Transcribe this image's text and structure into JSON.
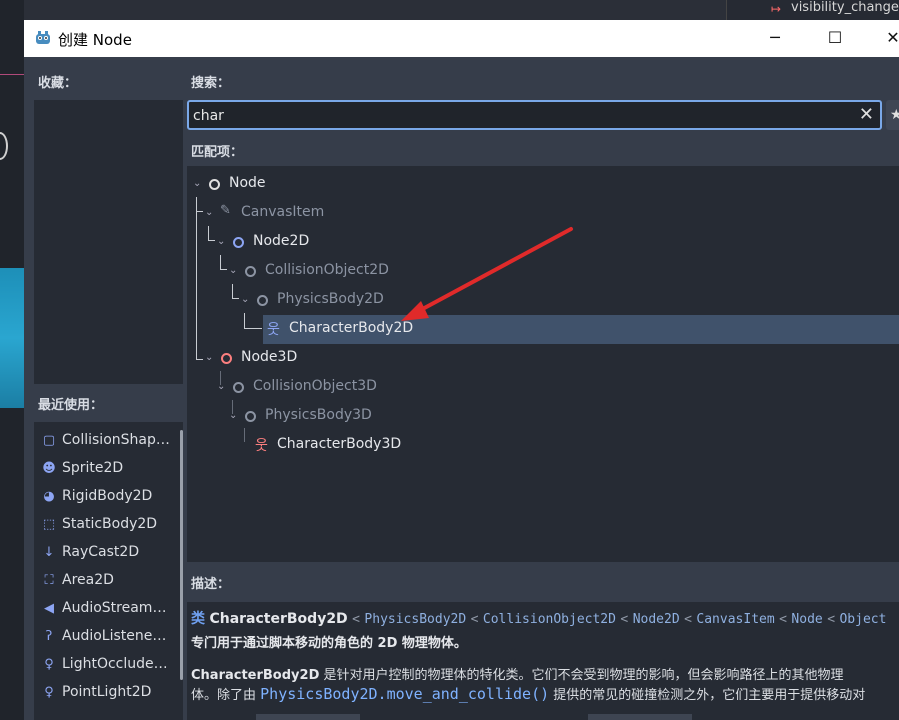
{
  "background": {
    "signal_label": "visibility_change"
  },
  "dialog": {
    "title": "创建 Node",
    "window_buttons": [
      "─",
      "☐",
      "✕"
    ]
  },
  "favorites": {
    "label": "收藏："
  },
  "recent": {
    "label": "最近使用：",
    "items": [
      {
        "label": "CollisionShape...",
        "icon": "collision-shape-icon",
        "color": "#8da5f3"
      },
      {
        "label": "Sprite2D",
        "icon": "sprite2d-icon",
        "color": "#8da5f3"
      },
      {
        "label": "RigidBody2D",
        "icon": "rigidbody2d-icon",
        "color": "#8da5f3"
      },
      {
        "label": "StaticBody2D",
        "icon": "staticbody2d-icon",
        "color": "#8da5f3"
      },
      {
        "label": "RayCast2D",
        "icon": "raycast2d-icon",
        "color": "#8da5f3"
      },
      {
        "label": "Area2D",
        "icon": "area2d-icon",
        "color": "#8da5f3"
      },
      {
        "label": "AudioStreamP...",
        "icon": "audio-stream-player-icon",
        "color": "#8da5f3"
      },
      {
        "label": "AudioListener...",
        "icon": "audio-listener-icon",
        "color": "#8da5f3"
      },
      {
        "label": "LightOccluder...",
        "icon": "light-occluder-icon",
        "color": "#8da5f3"
      },
      {
        "label": "PointLight2D",
        "icon": "point-light-icon",
        "color": "#8da5f3"
      }
    ]
  },
  "search": {
    "label": "搜索：",
    "value": "char",
    "clear_icon": "✕",
    "star_icon": "★"
  },
  "matches": {
    "label": "匹配项：",
    "tree": [
      {
        "label": "Node",
        "state": "bright",
        "icon_color": "#e0e0e0"
      },
      {
        "label": "CanvasItem",
        "state": "dim",
        "icon_color": "#8c94a3"
      },
      {
        "label": "Node2D",
        "state": "bright",
        "icon_color": "#8da5f3"
      },
      {
        "label": "CollisionObject2D",
        "state": "dim",
        "icon_color": "#8c94a3"
      },
      {
        "label": "PhysicsBody2D",
        "state": "dim",
        "icon_color": "#8c94a3"
      },
      {
        "label": "CharacterBody2D",
        "state": "selected",
        "icon_color": "#8da5f3"
      },
      {
        "label": "Node3D",
        "state": "bright",
        "icon_color": "#fc7f7f"
      },
      {
        "label": "CollisionObject3D",
        "state": "dim",
        "icon_color": "#8c94a3"
      },
      {
        "label": "PhysicsBody3D",
        "state": "dim",
        "icon_color": "#8c94a3"
      },
      {
        "label": "CharacterBody3D",
        "state": "bright",
        "icon_color": "#fc7f7f"
      }
    ]
  },
  "description": {
    "label": "描述：",
    "class_keyword": "类",
    "class_name": "CharacterBody2D",
    "inheritance": [
      "PhysicsBody2D",
      "CollisionObject2D",
      "Node2D",
      "CanvasItem",
      "Node",
      "Object"
    ],
    "separator": "<",
    "brief": "专门用于通过脚本移动的角色的 2D 物理物体。",
    "body_line1_bold": "CharacterBody2D",
    "body_line1_rest": " 是针对用户控制的物理体的特化类。它们不会受到物理的影响，但会影响路径上的其他物理",
    "body_line2_pre": "体。除了由 ",
    "body_line2_code": "PhysicsBody2D.move_and_collide()",
    "body_line2_post": " 提供的常见的碰撞检测之外，它们主要用于提供移动对"
  },
  "annotation_color": "#e02a2a"
}
